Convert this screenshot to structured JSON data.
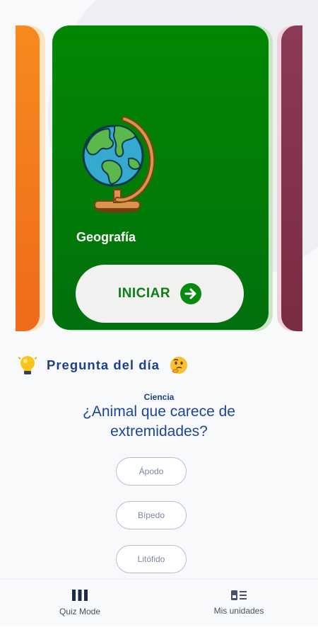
{
  "card": {
    "title": "Geografía",
    "start_label": "INICIAR",
    "colors": {
      "main": "#028702",
      "left": "#f68a1e",
      "right": "#8c3a57"
    }
  },
  "question_of_day": {
    "title": "Pregunta del día",
    "category": "Ciencia",
    "question": "¿Animal que carece de extremidades?",
    "options": [
      "Ápodo",
      "Bípedo",
      "Litófido"
    ]
  },
  "bottom_nav": {
    "items": [
      {
        "label": "Quiz Mode",
        "icon": "columns-icon"
      },
      {
        "label": "Mis unidades",
        "icon": "units-list-icon"
      }
    ]
  }
}
